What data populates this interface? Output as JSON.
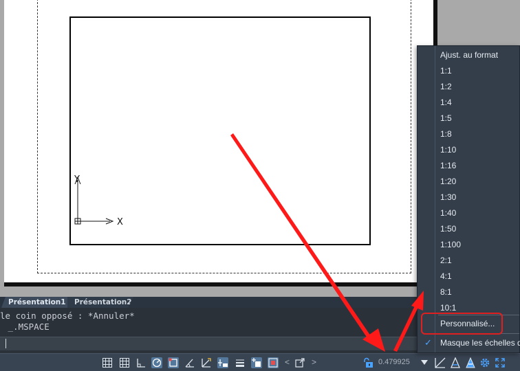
{
  "drawing": {
    "ucs_x_label": "X",
    "ucs_y_label": "Y"
  },
  "layout_tabs": [
    {
      "label": "Présentation1",
      "active": true
    },
    {
      "label": "Présentation2",
      "active": false
    }
  ],
  "command": {
    "history": [
      "le coin opposé : *Annuler*",
      " _.MSPACE"
    ]
  },
  "status_bar": {
    "scale_value": "0.479925",
    "prev_arrow": "<",
    "next_arrow": ">",
    "icons": [
      "grid-icon",
      "snap-grid-icon",
      "ortho-icon",
      "polar-tracking-icon",
      "object-snap-icon",
      "snap-angle-icon",
      "dynamic-ucs-icon",
      "dynamic-input-icon",
      "lineweight-icon",
      "transparency-icon",
      "selection-cycling-icon",
      "viewport-lock-icon",
      "annotation-scale-icon",
      "annotation-visibility-icon",
      "auto-scale-icon",
      "workspace-gear-icon",
      "fullscreen-icon"
    ]
  },
  "scale_menu": {
    "items": [
      "Ajust. au format",
      "1:1",
      "1:2",
      "1:4",
      "1:5",
      "1:8",
      "1:10",
      "1:16",
      "1:20",
      "1:30",
      "1:40",
      "1:50",
      "1:100",
      "2:1",
      "4:1",
      "8:1",
      "10:1",
      "Personnalisé...",
      "Masque les échelles de"
    ],
    "check_mark": "✓",
    "highlight_color": "#e02020"
  },
  "colors": {
    "accent": "#4aa3ff",
    "arrow": "#ff1a1a"
  }
}
